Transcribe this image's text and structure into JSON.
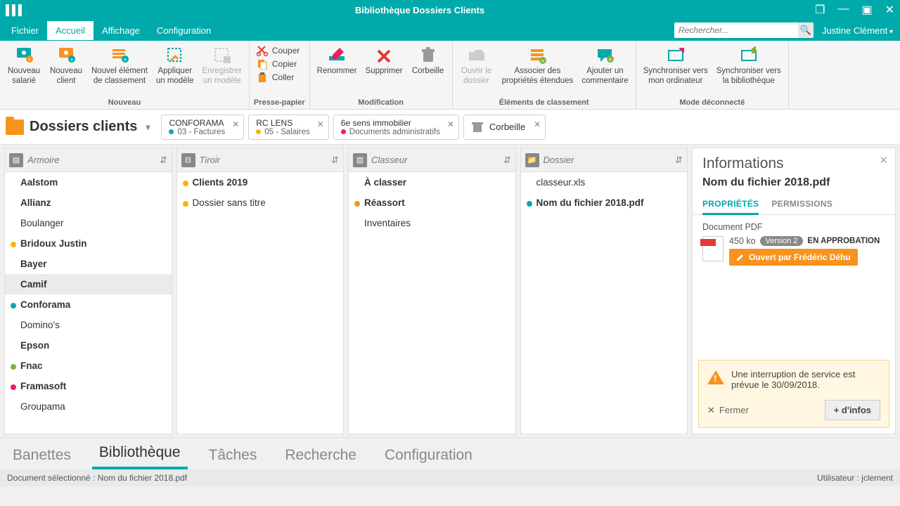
{
  "window": {
    "title": "Bibliothèque Dossiers Clients"
  },
  "menu": {
    "items": [
      "Fichier",
      "Accueil",
      "Affichage",
      "Configuration"
    ],
    "active": 1
  },
  "search": {
    "placeholder": "Rechercher..."
  },
  "user": {
    "name": "Justine Clément"
  },
  "ribbon": {
    "groups": [
      {
        "title": "Nouveau",
        "items": [
          {
            "label": "Nouveau\nsalarié",
            "icon": "user-plus"
          },
          {
            "label": "Nouveau\nclient",
            "icon": "user-plus-orange"
          },
          {
            "label": "Nouvel élément\nde classement",
            "icon": "stack-plus"
          },
          {
            "label": "Appliquer\nun modèle",
            "icon": "template-apply"
          },
          {
            "label": "Enregistrer\nun modèle",
            "icon": "template-save",
            "disabled": true
          }
        ]
      },
      {
        "title": "Presse-papier",
        "small": [
          {
            "label": "Couper",
            "icon": "cut"
          },
          {
            "label": "Copier",
            "icon": "copy"
          },
          {
            "label": "Coller",
            "icon": "paste"
          }
        ]
      },
      {
        "title": "Modification",
        "items": [
          {
            "label": "Renommer",
            "icon": "rename"
          },
          {
            "label": "Supprimer",
            "icon": "delete"
          },
          {
            "label": "Corbeille",
            "icon": "trash"
          }
        ]
      },
      {
        "title": "Éléments de classement",
        "items": [
          {
            "label": "Ouvrir le\ndossier",
            "icon": "folder-open",
            "disabled": true
          },
          {
            "label": "Associer des\npropriétés étendues",
            "icon": "properties"
          },
          {
            "label": "Ajouter un\ncommentaire",
            "icon": "comment"
          }
        ]
      },
      {
        "title": "Mode déconnecté",
        "items": [
          {
            "label": "Synchroniser vers\nmon ordinateur",
            "icon": "sync-down"
          },
          {
            "label": "Synchroniser vers\nla bibliothèque",
            "icon": "sync-up"
          }
        ]
      }
    ]
  },
  "library": {
    "title": "Dossiers clients"
  },
  "doctabs": [
    {
      "line1": "CONFORAMA",
      "line2": "03 - Factures",
      "dot": "#00aaab"
    },
    {
      "line1": "RC LENS",
      "line2": "05 - Salaires",
      "dot": "#f7b500"
    },
    {
      "line1": "6e sens immobilier",
      "line2": "Documents administratifs",
      "dot": "#e91e63"
    }
  ],
  "trash": {
    "label": "Corbeille"
  },
  "columns": [
    {
      "placeholder": "Armoire",
      "type": "armoire",
      "items": [
        {
          "label": "Aalstom",
          "bold": true
        },
        {
          "label": "Allianz",
          "bold": true
        },
        {
          "label": "Boulanger"
        },
        {
          "label": "Bridoux Justin",
          "bold": true,
          "dot": "#f7b500"
        },
        {
          "label": "Bayer",
          "bold": true
        },
        {
          "label": "Camif",
          "bold": true,
          "selected": true
        },
        {
          "label": "Conforama",
          "bold": true,
          "dot": "#00aaab"
        },
        {
          "label": "Domino's"
        },
        {
          "label": "Epson",
          "bold": true
        },
        {
          "label": "Fnac",
          "bold": true,
          "dot": "#7cb342"
        },
        {
          "label": "Framasoft",
          "bold": true,
          "dot": "#e91e63"
        },
        {
          "label": "Groupama"
        }
      ]
    },
    {
      "placeholder": "Tiroir",
      "type": "tiroir",
      "items": [
        {
          "label": "Clients 2019",
          "bold": true,
          "dot": "#f7b500"
        },
        {
          "label": "Dossier sans titre",
          "dot": "#f7b500"
        }
      ]
    },
    {
      "placeholder": "Classeur",
      "type": "classeur",
      "items": [
        {
          "label": "À classer",
          "bold": true
        },
        {
          "label": "Réassort",
          "bold": true,
          "dot": "#f7931e"
        },
        {
          "label": "Inventaires"
        }
      ]
    },
    {
      "placeholder": "Dossier",
      "type": "dossier",
      "items": [
        {
          "label": "classeur.xls"
        },
        {
          "label": "Nom du fichier 2018.pdf",
          "bold": true,
          "dot": "#00aaab"
        }
      ]
    }
  ],
  "info": {
    "header": "Informations",
    "filename": "Nom du fichier 2018.pdf",
    "tabs": [
      "PROPRIÉTÉS",
      "PERMISSIONS"
    ],
    "activeTab": 0,
    "doctype": "Document PDF",
    "size": "450 ko",
    "version": "Version 2",
    "status": "EN APPROBATION",
    "openby": "Ouvert par Frédéric Déhu"
  },
  "alert": {
    "text": "Une interruption de service est prévue le 30/09/2018.",
    "close": "Fermer",
    "more": "+ d'infos"
  },
  "bottomtabs": {
    "items": [
      "Banettes",
      "Bibliothèque",
      "Tâches",
      "Recherche",
      "Configuration"
    ],
    "active": 1
  },
  "status": {
    "left": "Document sélectionné : Nom du fichier 2018.pdf",
    "right": "Utilisateur : jclement"
  }
}
